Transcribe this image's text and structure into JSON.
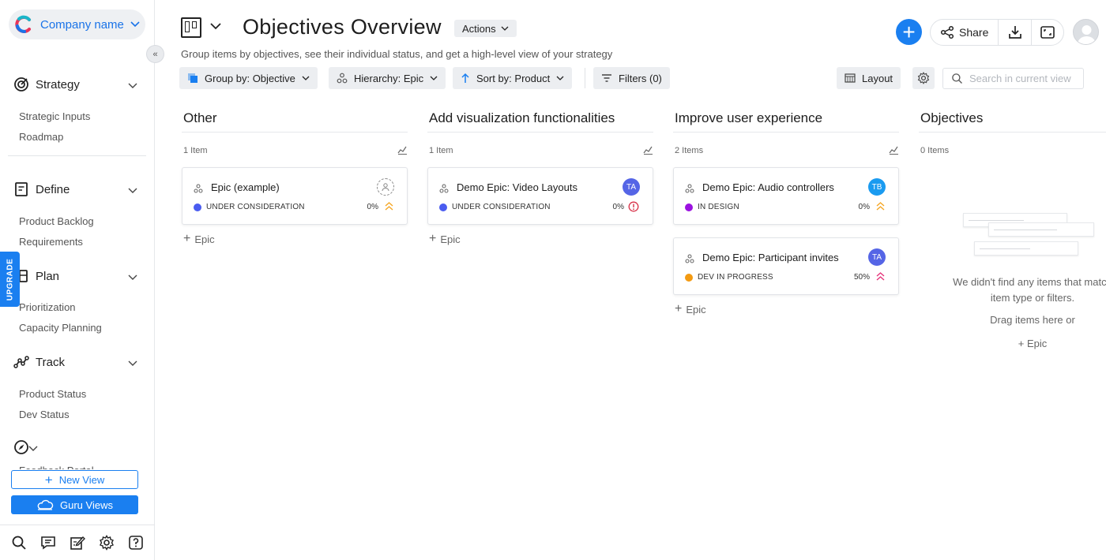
{
  "sidebar": {
    "company_name": "Company name",
    "sections": [
      {
        "label": "Strategy",
        "items": [
          "Strategic Inputs",
          "Roadmap"
        ]
      },
      {
        "label": "Define",
        "items": [
          "Product Backlog",
          "Requirements"
        ]
      },
      {
        "label": "Plan",
        "items": [
          "Prioritization",
          "Capacity Planning"
        ]
      },
      {
        "label": "Track",
        "items": [
          "Product Status",
          "Dev Status"
        ]
      },
      {
        "label": "",
        "items": [
          "Feedback Portal"
        ]
      }
    ],
    "upgrade_label": "UPGRADE",
    "new_view_label": "New View",
    "guru_views_label": "Guru Views"
  },
  "header": {
    "title": "Objectives Overview",
    "actions_label": "Actions",
    "subtitle": "Group items by objectives, see their individual status, and get a high-level view of your strategy",
    "share_label": "Share"
  },
  "toolbar": {
    "group_by": "Group by: Objective",
    "hierarchy": "Hierarchy: Epic",
    "sort_by": "Sort by: Product",
    "filters": "Filters (0)",
    "layout": "Layout",
    "search_placeholder": "Search in current view"
  },
  "columns": [
    {
      "title": "Other",
      "count": "1 Item",
      "cards": [
        {
          "title": "Epic (example)",
          "status": "UNDER CONSIDERATION",
          "status_color": "#4a5cf0",
          "progress": "0%",
          "assignee": "",
          "priority": "medium"
        }
      ],
      "add_label": "Epic"
    },
    {
      "title": "Add visualization functionalities",
      "count": "1 Item",
      "cards": [
        {
          "title": "Demo Epic: Video Layouts",
          "status": "UNDER CONSIDERATION",
          "status_color": "#4a5cf0",
          "progress": "0%",
          "assignee": "TA",
          "assignee_color": "#5565e6",
          "priority": "critical"
        }
      ],
      "add_label": "Epic"
    },
    {
      "title": "Improve user experience",
      "count": "2 Items",
      "cards": [
        {
          "title": "Demo Epic: Audio controllers",
          "status": "IN DESIGN",
          "status_color": "#9b12e0",
          "progress": "0%",
          "assignee": "TB",
          "assignee_color": "#1a9bf0",
          "priority": "medium"
        },
        {
          "title": "Demo Epic: Participant invites",
          "status": "DEV IN PROGRESS",
          "status_color": "#f39a12",
          "progress": "50%",
          "assignee": "TA",
          "assignee_color": "#5565e6",
          "priority": "high"
        }
      ],
      "add_label": "Epic"
    },
    {
      "title": "Objectives",
      "count": "0 Items",
      "cards": [],
      "add_label": "Epic"
    }
  ],
  "empty_state": {
    "message": "We didn't find any items that match item type or filters.",
    "drag_text": "Drag items here or",
    "add_label": "Epic"
  },
  "colors": {
    "accent": "#1a7ff0",
    "priority_medium": "#f5a623",
    "priority_high": "#e5347a",
    "priority_critical": "#d8334a"
  }
}
